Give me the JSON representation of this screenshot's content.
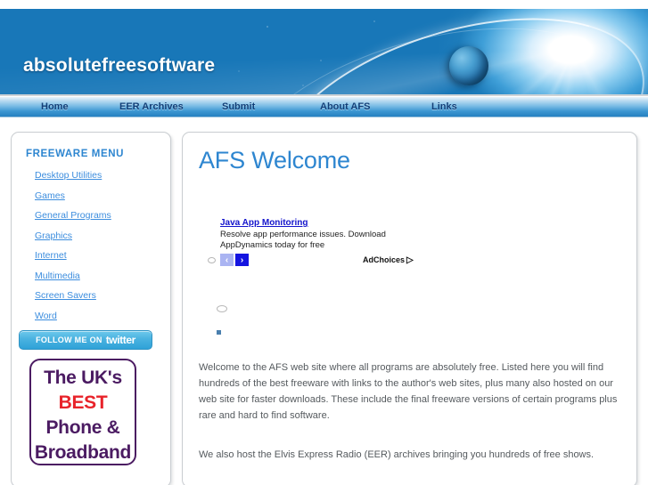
{
  "site": {
    "banner_title": "absolutefreesoftware",
    "banner_bg_color": "#1877b8",
    "accent_color": "#2e86d0",
    "link_color": "#3c8dde"
  },
  "nav": {
    "items": [
      {
        "label": "Home"
      },
      {
        "label": "EER Archives"
      },
      {
        "label": "Submit"
      },
      {
        "label": "About AFS"
      },
      {
        "label": "Links"
      }
    ]
  },
  "sidebar": {
    "title": "FREEWARE MENU",
    "items": [
      {
        "label": "Desktop Utilities"
      },
      {
        "label": "Games"
      },
      {
        "label": "General Programs"
      },
      {
        "label": "Graphics"
      },
      {
        "label": "Internet"
      },
      {
        "label": "Multimedia"
      },
      {
        "label": "Screen Savers"
      },
      {
        "label": "Word"
      }
    ],
    "twitter": {
      "prefix": "Follow me on",
      "brand": "twitter",
      "bg_color": "#49b2e0"
    },
    "uk_ad": {
      "line1": "The UK's",
      "line2": "BEST",
      "line3": "Phone &",
      "line4": "Broadband",
      "border_color": "#4b1b62",
      "highlight_color": "#e8232a"
    }
  },
  "main": {
    "heading": "AFS Welcome",
    "ad": {
      "title": "Java App Monitoring",
      "line1": "Resolve app performance issues. Download",
      "line2": "AppDynamics today for free",
      "prev_label": "‹",
      "next_label": "›",
      "adchoices_label": "AdChoices",
      "adchoices_glyph": "▷"
    },
    "paragraphs": [
      "Welcome to the AFS web site where all programs are absolutely free. Listed here you will find hundreds of the best freeware with links to the author's web sites, plus many also hosted on our web site for faster downloads. These include the final freeware versions of certain programs plus rare and hard to find software.",
      "We also host the Elvis Express Radio (EER) archives bringing you hundreds of free shows."
    ]
  }
}
